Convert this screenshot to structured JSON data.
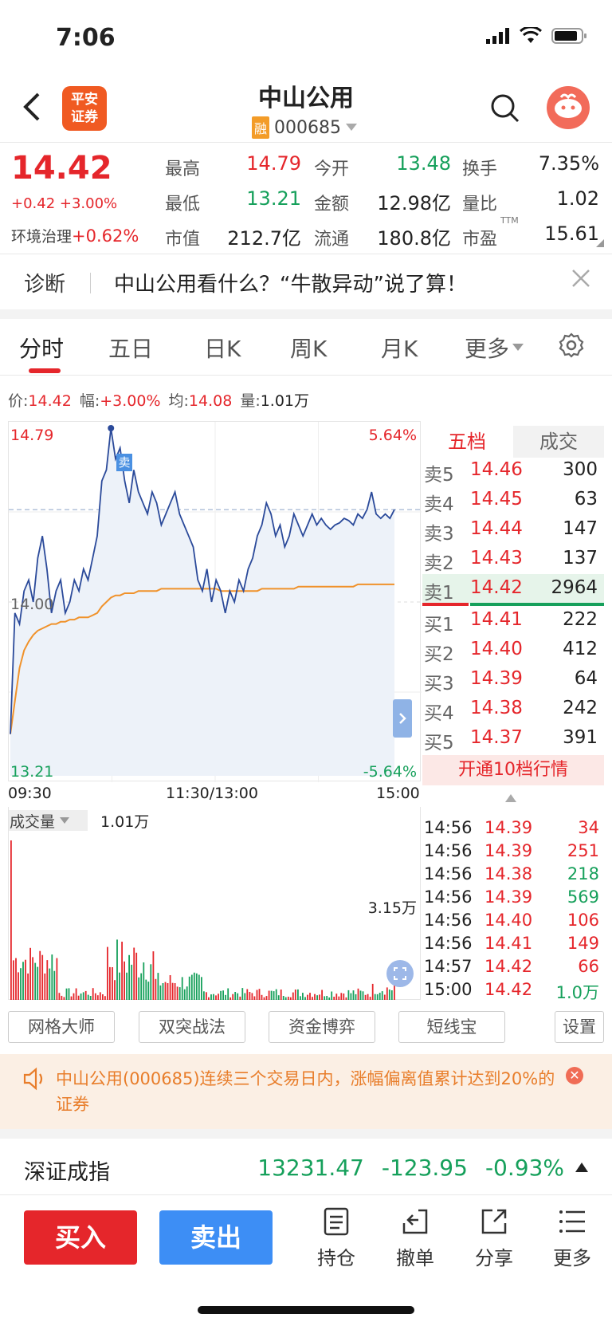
{
  "status": {
    "time": "7:06"
  },
  "header": {
    "brand_logo": "平安\n证券",
    "stock_name": "中山公用",
    "rong_badge": "融",
    "stock_code": "000685"
  },
  "quote": {
    "price": "14.42",
    "change": "+0.42 +3.00%",
    "sector_name": "环境治理",
    "sector_change": "+0.62%",
    "fields": [
      {
        "label": "最高",
        "value": "14.79",
        "color": "red"
      },
      {
        "label": "今开",
        "value": "13.48",
        "color": "green"
      },
      {
        "label": "换手",
        "value": "7.35%",
        "color": "dark"
      },
      {
        "label": "最低",
        "value": "13.21",
        "color": "green"
      },
      {
        "label": "金额",
        "value": "12.98亿",
        "color": "dark"
      },
      {
        "label": "量比",
        "value": "1.02",
        "color": "dark"
      },
      {
        "label": "市值",
        "value": "212.7亿",
        "color": "dark"
      },
      {
        "label": "流通",
        "value": "180.8亿",
        "color": "dark"
      },
      {
        "label": "市盈",
        "value": "15.61",
        "color": "dark",
        "sup": "TTM"
      }
    ]
  },
  "diagnosis": {
    "label": "诊断",
    "text": "中山公用看什么？“牛散异动”说了算！"
  },
  "tabs": [
    "分时",
    "五日",
    "日K",
    "周K",
    "月K",
    "更多"
  ],
  "info_line": {
    "price_label": "价:",
    "price": "14.42",
    "amp_label": "幅:",
    "amp": "+3.00%",
    "avg_label": "均:",
    "avg": "14.08",
    "vol_label": "量:",
    "vol": "1.01万"
  },
  "chart": {
    "high": "14.79",
    "low": "13.21",
    "mid": "14.00",
    "high_pct": "5.64%",
    "low_pct": "-5.64%",
    "time_start": "09:30",
    "time_mid": "11:30/13:00",
    "time_end": "15:00",
    "sell_marker": "卖",
    "vol_label": "成交量",
    "vol_value": "1.01万",
    "vol_max": "3.15万"
  },
  "chart_data": {
    "type": "line",
    "ylim": [
      13.21,
      14.79
    ],
    "prev_close": 14.0,
    "series": [
      {
        "values": [
          13.4,
          13.95,
          13.9,
          14.05,
          14.1,
          14.0,
          14.2,
          14.3,
          14.15,
          13.95,
          14.05,
          14.1,
          13.95,
          14.0,
          14.1,
          14.05,
          14.15,
          14.1,
          14.2,
          14.3,
          14.55,
          14.6,
          14.79,
          14.65,
          14.7,
          14.55,
          14.45,
          14.6,
          14.5,
          14.45,
          14.4,
          14.5,
          14.45,
          14.35,
          14.4,
          14.45,
          14.5,
          14.4,
          14.35,
          14.3,
          14.25,
          14.1,
          14.05,
          14.15,
          14.0,
          14.1,
          14.05,
          13.95,
          14.05,
          14.0,
          14.1,
          14.05,
          14.15,
          14.2,
          14.3,
          14.35,
          14.45,
          14.4,
          14.3,
          14.35,
          14.25,
          14.3,
          14.4,
          14.35,
          14.3,
          14.35,
          14.4,
          14.35,
          14.38,
          14.35,
          14.33,
          14.35,
          14.36,
          14.38,
          14.37,
          14.35,
          14.4,
          14.38,
          14.42,
          14.5,
          14.4,
          14.38,
          14.4,
          14.38,
          14.42
        ]
      },
      {
        "values": [
          13.4,
          13.55,
          13.7,
          13.78,
          13.82,
          13.85,
          13.87,
          13.88,
          13.89,
          13.9,
          13.9,
          13.91,
          13.91,
          13.92,
          13.92,
          13.93,
          13.93,
          13.93,
          13.94,
          13.95,
          13.98,
          14.0,
          14.02,
          14.03,
          14.03,
          14.04,
          14.04,
          14.04,
          14.05,
          14.05,
          14.05,
          14.05,
          14.05,
          14.06,
          14.06,
          14.06,
          14.06,
          14.06,
          14.06,
          14.06,
          14.06,
          14.06,
          14.06,
          14.06,
          14.06,
          14.06,
          14.05,
          14.05,
          14.05,
          14.05,
          14.05,
          14.05,
          14.05,
          14.05,
          14.05,
          14.06,
          14.06,
          14.06,
          14.06,
          14.06,
          14.06,
          14.06,
          14.06,
          14.07,
          14.07,
          14.07,
          14.07,
          14.07,
          14.07,
          14.07,
          14.07,
          14.07,
          14.07,
          14.07,
          14.07,
          14.07,
          14.08,
          14.08,
          14.08,
          14.08,
          14.08,
          14.08,
          14.08,
          14.08,
          14.08
        ]
      }
    ]
  },
  "orderbook": {
    "tab_five": "五档",
    "tab_trades": "成交",
    "asks": [
      {
        "label": "卖5",
        "price": "14.46",
        "vol": "300"
      },
      {
        "label": "卖4",
        "price": "14.45",
        "vol": "63"
      },
      {
        "label": "卖3",
        "price": "14.44",
        "vol": "147"
      },
      {
        "label": "卖2",
        "price": "14.43",
        "vol": "137"
      },
      {
        "label": "卖1",
        "price": "14.42",
        "vol": "2964"
      }
    ],
    "bids": [
      {
        "label": "买1",
        "price": "14.41",
        "vol": "222"
      },
      {
        "label": "买2",
        "price": "14.40",
        "vol": "412"
      },
      {
        "label": "买3",
        "price": "14.39",
        "vol": "64"
      },
      {
        "label": "买4",
        "price": "14.38",
        "vol": "242"
      },
      {
        "label": "买5",
        "price": "14.37",
        "vol": "391"
      }
    ],
    "upgrade": "开通10档行情",
    "ticks": [
      {
        "time": "14:56",
        "price": "14.39",
        "vol": "34",
        "color": "red"
      },
      {
        "time": "14:56",
        "price": "14.39",
        "vol": "251",
        "color": "red"
      },
      {
        "time": "14:56",
        "price": "14.38",
        "vol": "218",
        "color": "green"
      },
      {
        "time": "14:56",
        "price": "14.39",
        "vol": "569",
        "color": "green"
      },
      {
        "time": "14:56",
        "price": "14.40",
        "vol": "106",
        "color": "red"
      },
      {
        "time": "14:56",
        "price": "14.41",
        "vol": "149",
        "color": "red"
      },
      {
        "time": "14:57",
        "price": "14.42",
        "vol": "66",
        "color": "red"
      },
      {
        "time": "15:00",
        "price": "14.42",
        "vol": "1.0万",
        "color": "green"
      }
    ]
  },
  "strategies": [
    "网格大师",
    "双突战法",
    "资金博弈",
    "短线宝",
    "设置"
  ],
  "notice": {
    "text": "中山公用(000685)连续三个交易日内，涨幅偏离值累计达到20%的证券"
  },
  "index": {
    "name": "深证成指",
    "value": "13231.47",
    "change": "-123.95",
    "pct": "-0.93%"
  },
  "bottom": {
    "buy": "买入",
    "sell": "卖出",
    "items": [
      "持仓",
      "撤单",
      "分享",
      "更多"
    ]
  }
}
